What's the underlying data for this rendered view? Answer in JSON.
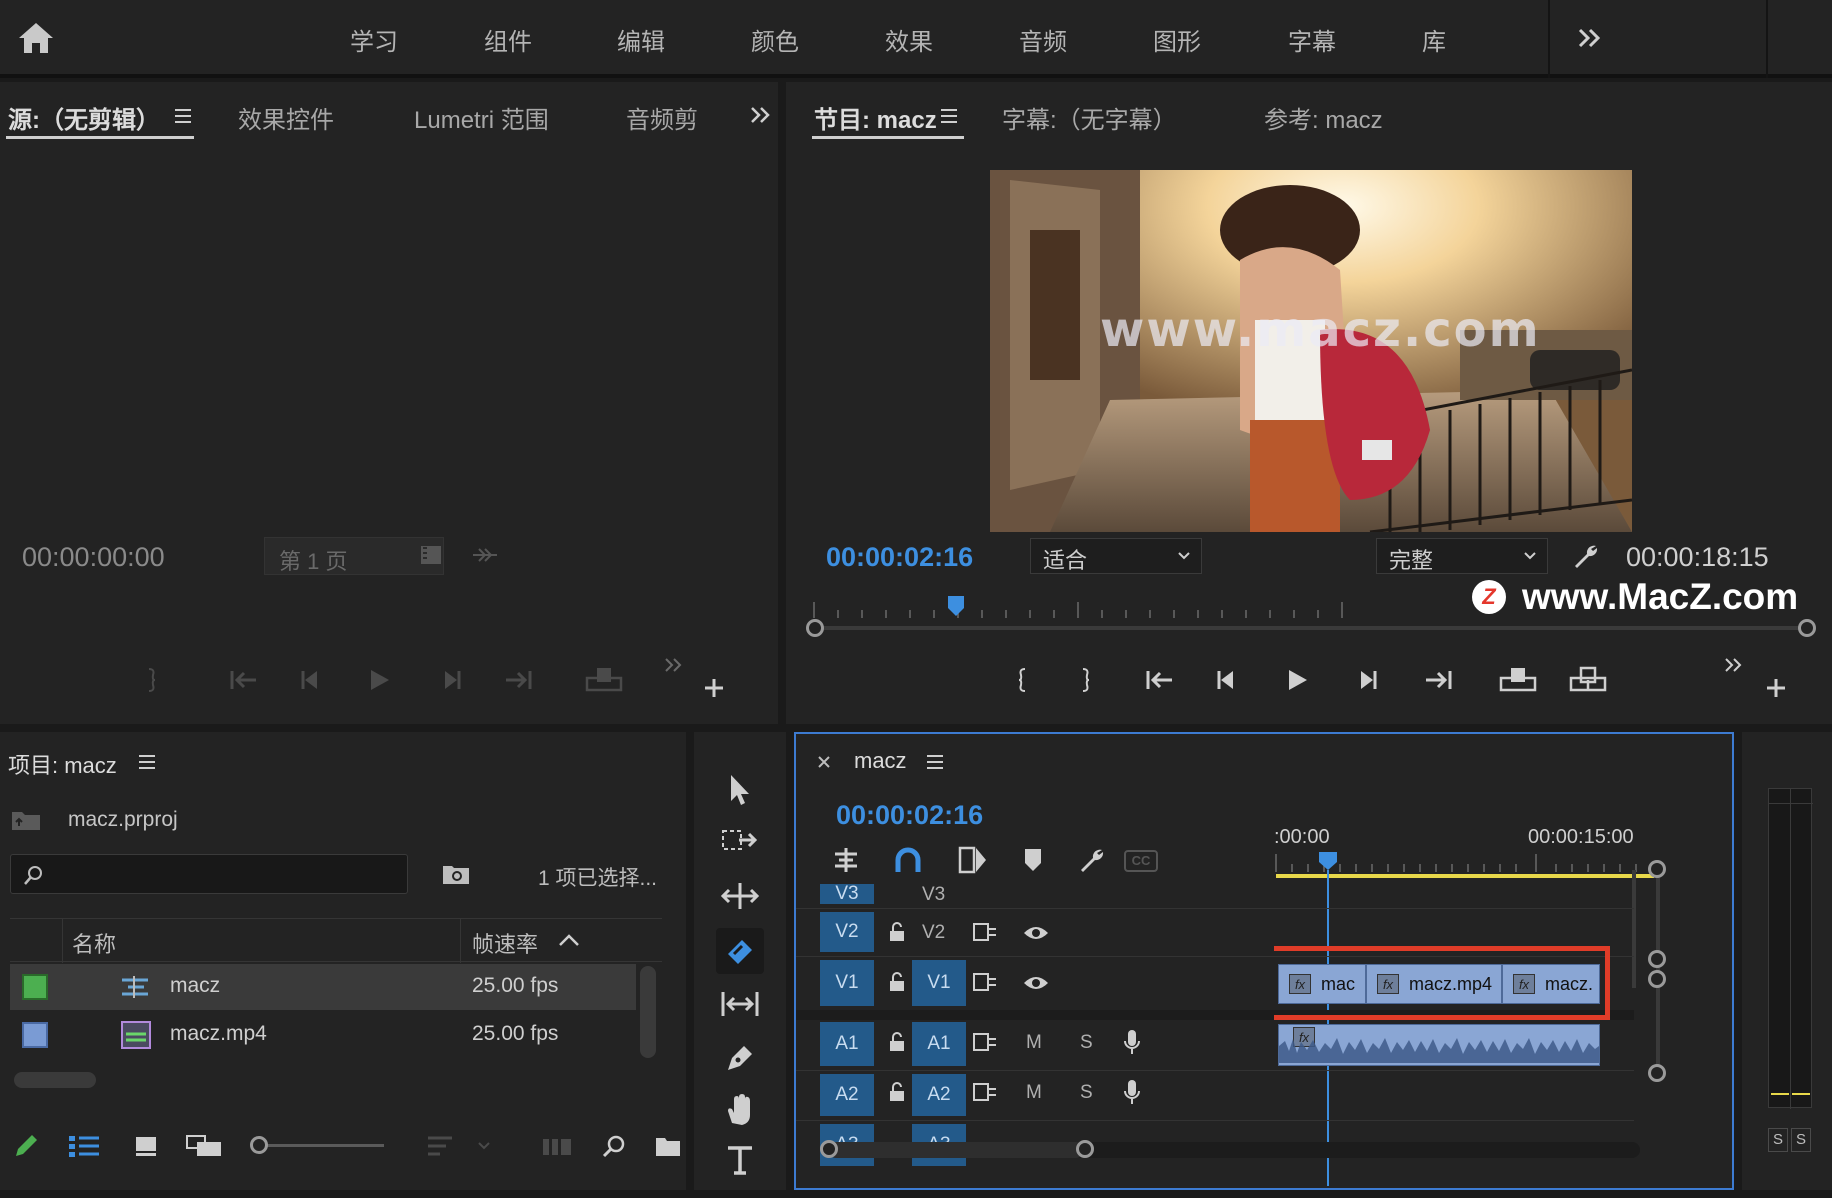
{
  "workspaces": [
    "学习",
    "组件",
    "编辑",
    "颜色",
    "效果",
    "音频",
    "图形",
    "字幕",
    "库"
  ],
  "source_panel": {
    "tabs": [
      "源:（无剪辑）",
      "效果控件",
      "Lumetri 范围",
      "音频剪"
    ],
    "timecode": "00:00:00:00",
    "page": "第 1 页"
  },
  "program_panel": {
    "tabs": [
      "节目: macz",
      "字幕:（无字幕）",
      "参考: macz"
    ],
    "video_watermark": "www.macz.com",
    "timecode": "00:00:02:16",
    "fit": "适合",
    "quality": "完整",
    "duration": "00:00:18:15",
    "site_watermark": "www.MacZ.com"
  },
  "project_panel": {
    "title": "项目: macz",
    "file": "macz.prproj",
    "selection": "1 项已选择...",
    "columns": [
      "名称",
      "帧速率"
    ],
    "rows": [
      {
        "name": "macz",
        "fps": "25.00 fps",
        "color": "#4caf50"
      },
      {
        "name": "macz.mp4",
        "fps": "25.00 fps",
        "color": "#7a9bd4"
      }
    ]
  },
  "timeline": {
    "sequence": "macz",
    "timecode": "00:00:02:16",
    "ruler": [
      ":00:00",
      "00:00:15:00"
    ],
    "tracks": {
      "video": [
        {
          "toggle": "V3",
          "target": "V3"
        },
        {
          "toggle": "V2",
          "target": "V2"
        },
        {
          "toggle": "V1",
          "target": "V1"
        }
      ],
      "audio": [
        {
          "toggle": "A1",
          "target": "A1"
        },
        {
          "toggle": "A2",
          "target": "A2"
        },
        {
          "toggle": "A3",
          "target": "A3"
        }
      ],
      "mute": "M",
      "solo": "S"
    },
    "clips": [
      "mac",
      "macz.mp4",
      "macz."
    ],
    "cc": "CC"
  },
  "meter": {
    "solo": [
      "S",
      "S"
    ]
  },
  "colors": {
    "accent": "#3d8fe0",
    "highlight": "#e03c28",
    "work_area": "#e8d84a"
  }
}
